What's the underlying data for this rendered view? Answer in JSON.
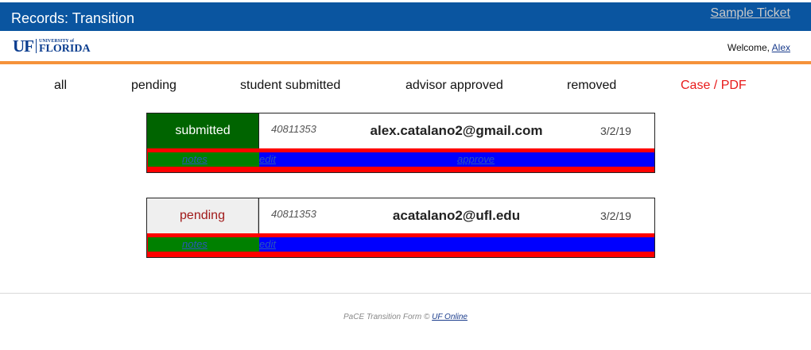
{
  "header": {
    "title": "Records: Transition",
    "sample_ticket": "Sample Ticket"
  },
  "subheader": {
    "logo": {
      "abbrev": "UF",
      "small": "UNIVERSITY of",
      "big": "FLORIDA"
    },
    "welcome_prefix": "Welcome,",
    "user": "Alex"
  },
  "tabs": [
    "all",
    "pending",
    "student submitted",
    "advisor approved",
    "removed",
    "Case / PDF"
  ],
  "records": [
    {
      "status": "submitted",
      "id": "40811353",
      "email": "alex.catalano2@gmail.com",
      "date": "3/2/19",
      "actions": [
        "notes",
        "edit",
        "approve"
      ]
    },
    {
      "status": "pending",
      "id": "40811353",
      "email": "acatalano2@ufl.edu",
      "date": "3/2/19",
      "actions": [
        "notes",
        "edit"
      ]
    }
  ],
  "footer": {
    "text": "PaCE Transition Form ©",
    "link": "UF Online"
  },
  "colors": {
    "topbar": "#0a55a0",
    "accent_orange": "#f5923a",
    "submitted_green": "#006400",
    "pending_red_text": "#a11a1a",
    "action_red": "#ff0000",
    "action_green": "#008000",
    "action_blue": "#0000ff"
  }
}
